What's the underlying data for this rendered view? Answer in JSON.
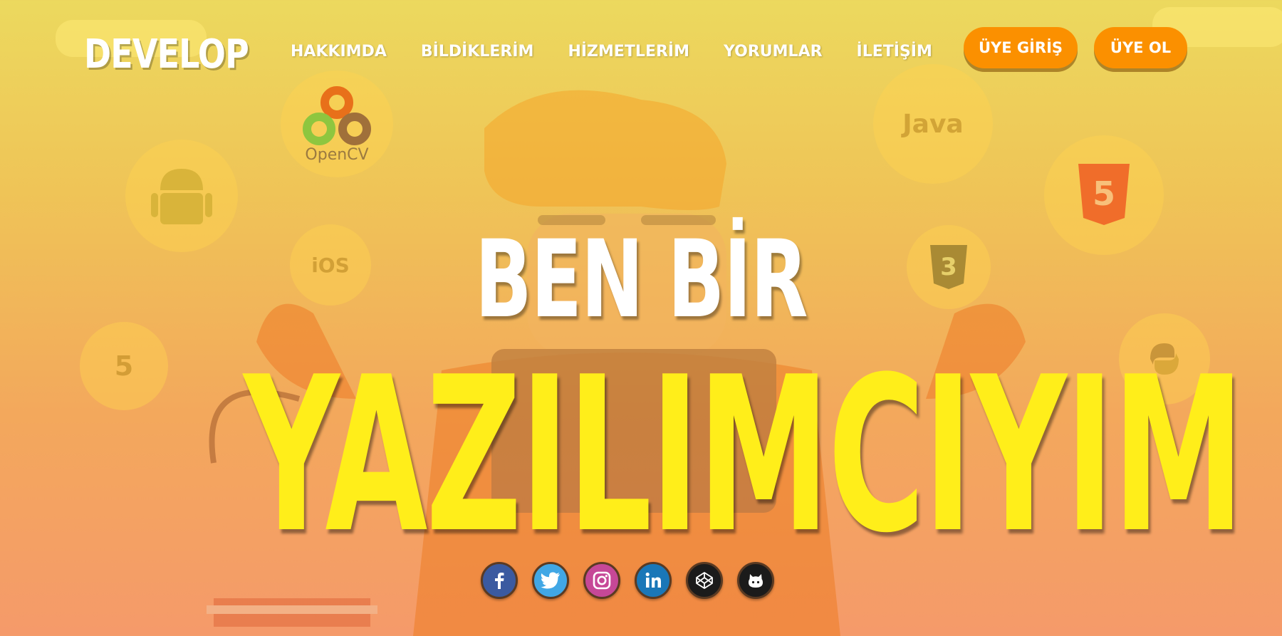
{
  "header": {
    "logo": "DEVELOP",
    "nav": [
      "HAKKIMDA",
      "BİLDİKLERİM",
      "HİZMETLERİM",
      "YORUMLAR",
      "İLETİŞİM"
    ],
    "login_label": "ÜYE GİRİŞ",
    "signup_label": "ÜYE OL"
  },
  "background_icons": {
    "opencv": "OpenCV",
    "java": "Java",
    "ios": "iOS"
  },
  "hero": {
    "line1": "BEN BİR",
    "line2": "YAZILIMCIYIM"
  },
  "social": [
    "facebook-icon",
    "twitter-icon",
    "instagram-icon",
    "linkedin-icon",
    "codepen-icon",
    "github-icon"
  ],
  "colors": {
    "accent_button": "#fb9000",
    "hero_highlight": "#ffee1a"
  }
}
